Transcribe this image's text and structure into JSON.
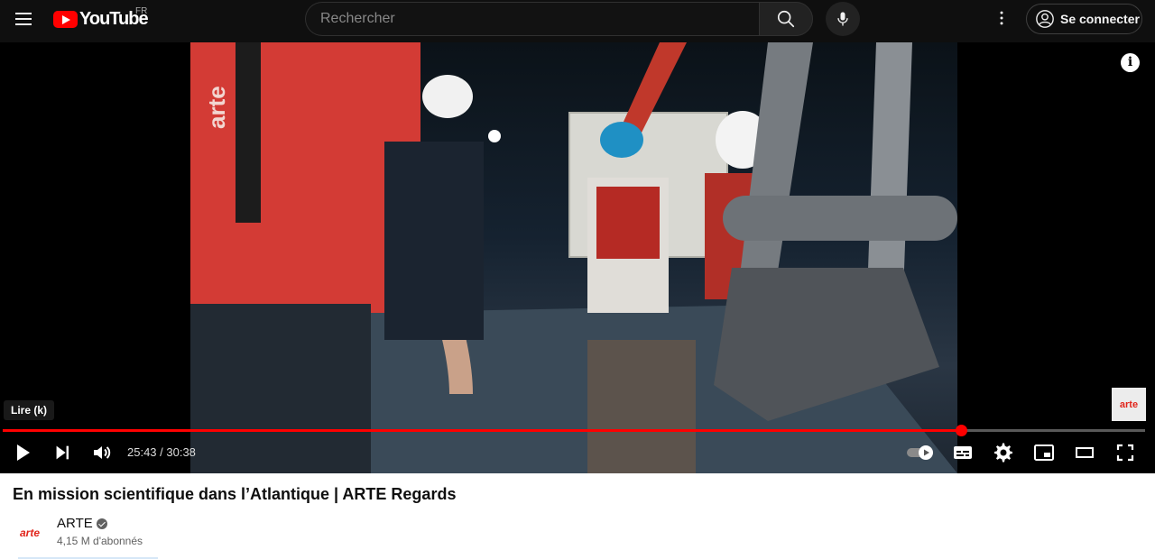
{
  "header": {
    "logo_text": "YouTube",
    "country_code": "FR",
    "search_placeholder": "Rechercher",
    "signin_label": "Se connecter",
    "colors": {
      "background": "#0f0f0f",
      "brand_red": "#ff0000"
    }
  },
  "player": {
    "tooltip": "Lire (k)",
    "current_time": "25:43",
    "duration": "30:38",
    "time_display": "25:43 / 30:38",
    "progress_fraction": 0.839,
    "progress_color": "#ff0000",
    "info_icon_label": "i",
    "watermark_text": "arte",
    "video_overlay_logo": "arte",
    "icons": [
      "play-icon",
      "next-icon",
      "volume-icon",
      "autoplay-toggle-icon",
      "subtitles-icon",
      "settings-icon",
      "miniplayer-icon",
      "theater-mode-icon",
      "fullscreen-icon"
    ]
  },
  "video": {
    "title": "En mission scientifique dans l’Atlantique | ARTE Regards",
    "channel": {
      "name": "ARTE",
      "avatar_text": "arte",
      "subscribers": "4,15 M d'abonnés",
      "brand_color": "#e1251b"
    }
  }
}
